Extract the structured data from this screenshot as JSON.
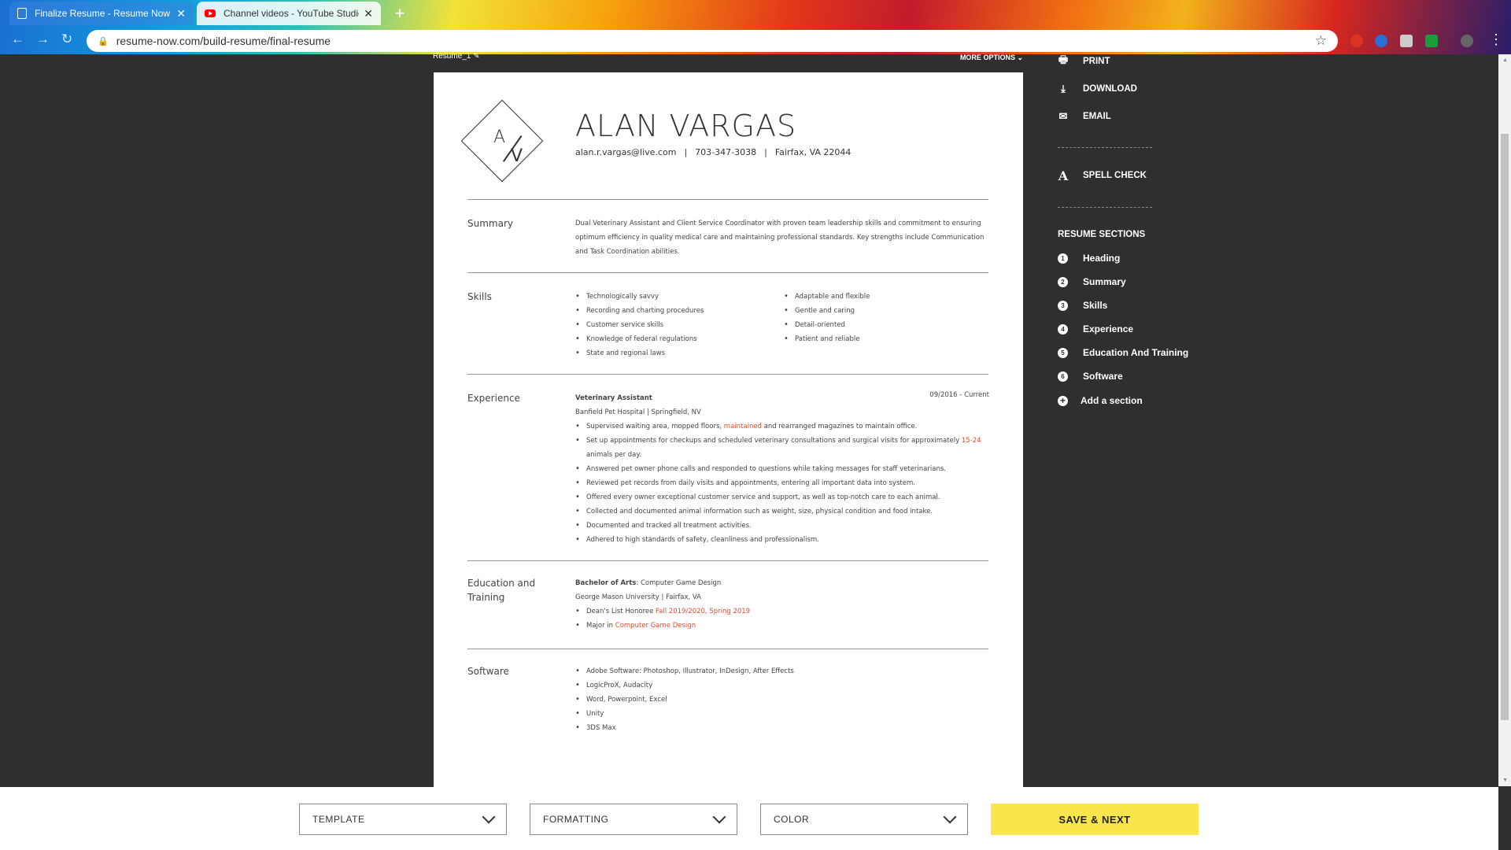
{
  "browser": {
    "tabs": [
      {
        "title": "Finalize Resume - Resume Now",
        "active": true
      },
      {
        "title": "Channel videos - YouTube Studio",
        "active": false
      }
    ],
    "url": "resume-now.com/build-resume/final-resume"
  },
  "page": {
    "resume_name": "Resume_1",
    "more_options": "MORE OPTIONS"
  },
  "resume": {
    "monogram": {
      "a": "A",
      "v": "V"
    },
    "name": "ALAN VARGAS",
    "email": "alan.r.vargas@live.com",
    "phone": "703-347-3038",
    "location": "Fairfax, VA 22044",
    "sections": {
      "summary": {
        "label": "Summary",
        "text": "Dual Veterinary Assistant and Client Service Coordinator with proven team leadership skills and commitment to ensuring optimum efficiency in quality medical care and maintaining professional standards. Key strengths include Communication and Task Coordination abilities."
      },
      "skills": {
        "label": "Skills",
        "left": [
          "Technologically savvy",
          "Recording and charting procedures",
          "Customer service skills",
          "Knowledge of federal regulations",
          "State and regional laws"
        ],
        "right": [
          "Adaptable and flexible",
          "Gentle and caring",
          "Detail-oriented",
          "Patient and reliable"
        ]
      },
      "experience": {
        "label": "Experience",
        "title": "Veterinary Assistant",
        "date": "09/2016 - Current",
        "employer": "Banfield Pet Hospital | Springfield, NV",
        "b1_pre": "Supervised waiting area, mopped floors, ",
        "b1_red": "maintained",
        "b1_post": " and rearranged magazines to maintain office.",
        "b2_pre": "Set up appointments for checkups and scheduled veterinary consultations and surgical visits for approximately ",
        "b2_red": "15-24",
        "b2_post": " animals per day.",
        "b3": "Answered pet owner phone calls and responded to questions while taking messages for staff veterinarians.",
        "b4": "Reviewed pet records from daily visits and appointments, entering all important data into system.",
        "b5": "Offered every owner exceptional customer service and support, as well as top-notch care to each animal.",
        "b6": "Collected and documented animal information such as weight, size, physical condition and food intake.",
        "b7": "Documented and tracked all treatment activities.",
        "b8": "Adhered to high standards of safety, cleanliness and professionalism."
      },
      "education": {
        "label": "Education and Training",
        "degree": "Bachelor of Arts",
        "field": ": Computer Game Design",
        "school": "George Mason University | Fairfax, VA",
        "b1_pre": "Dean's List Honoree ",
        "b1_red": "Fall 2019/2020, Spring 2019",
        "b2_pre": "Major in ",
        "b2_red": "Computer Game Design"
      },
      "software": {
        "label": "Software",
        "items": [
          "Adobe Software: Photoshop, Illustrator, InDesign, After Effects",
          "LogicProX, Audacity",
          "Word, Powerpoint, Excel",
          "Unity",
          "3DS Max"
        ]
      }
    }
  },
  "sidebar": {
    "print": "PRINT",
    "download": "DOWNLOAD",
    "email": "EMAIL",
    "spell_check": "SPELL CHECK",
    "sections_title": "RESUME SECTIONS",
    "sections": [
      {
        "num": "1",
        "label": "Heading"
      },
      {
        "num": "2",
        "label": "Summary"
      },
      {
        "num": "3",
        "label": "Skills"
      },
      {
        "num": "4",
        "label": "Experience"
      },
      {
        "num": "5",
        "label": "Education And Training"
      },
      {
        "num": "6",
        "label": "Software"
      }
    ],
    "add_section": "Add a section"
  },
  "bottom": {
    "template": "TEMPLATE",
    "formatting": "FORMATTING",
    "color": "COLOR",
    "save_next": "SAVE & NEXT"
  },
  "colors": {
    "accent_red": "#e04a2f",
    "save_yellow": "#fbe54c",
    "dark_bg": "#2f2f2f"
  }
}
